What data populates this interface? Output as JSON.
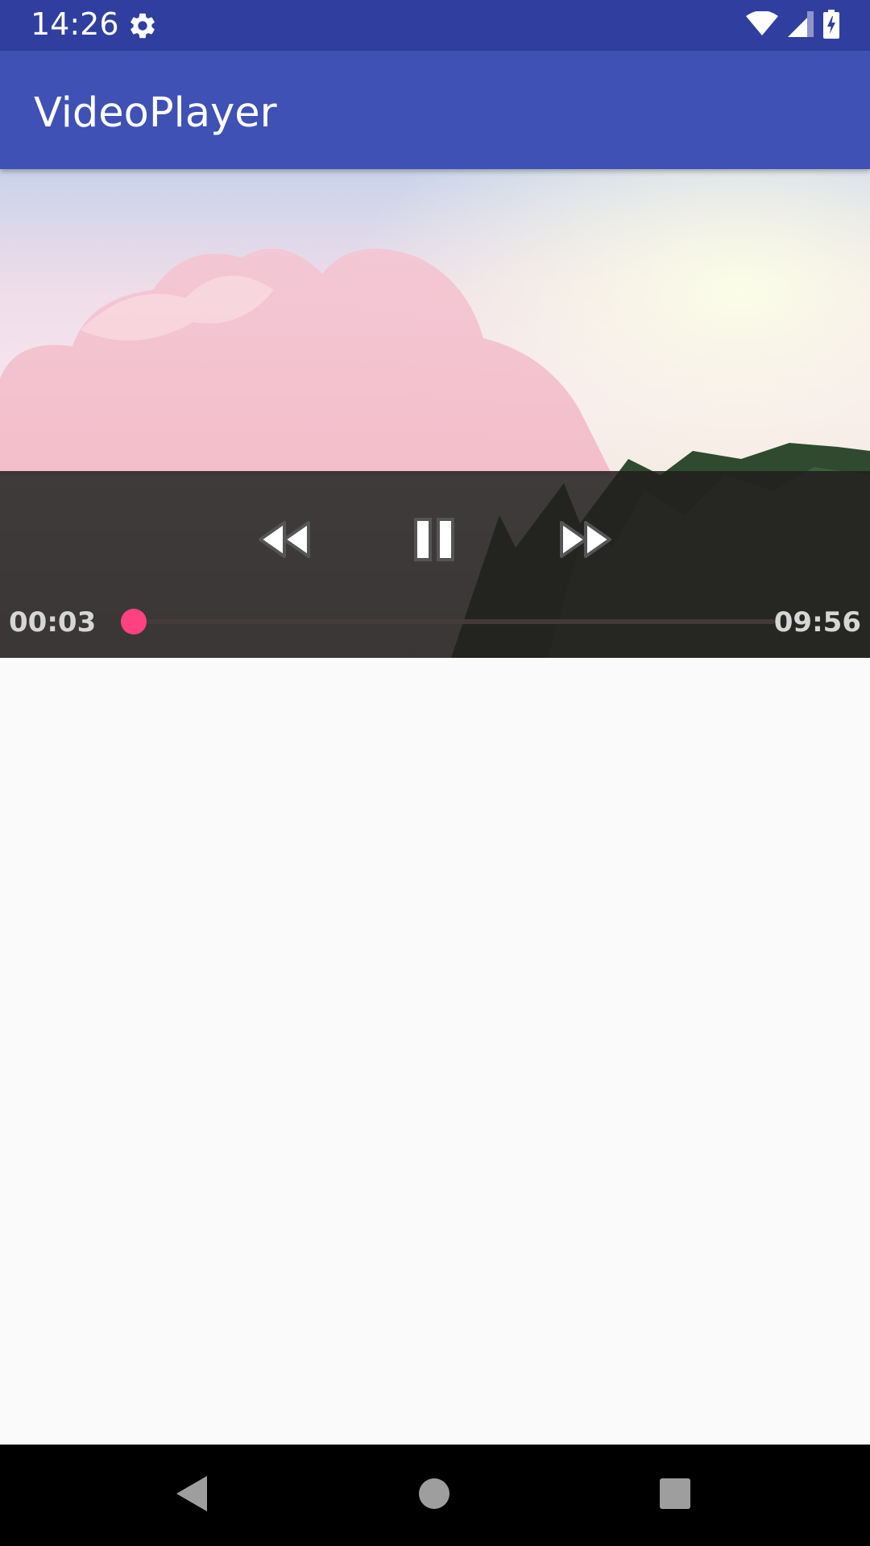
{
  "status_bar": {
    "time": "14:26",
    "icons": [
      "gear-icon",
      "wifi-icon",
      "signal-icon",
      "battery-charging-icon"
    ],
    "background": "#303f9f"
  },
  "app_bar": {
    "title": "VideoPlayer",
    "background": "#3f51b5"
  },
  "player": {
    "controls": {
      "rewind_icon": "rewind-icon",
      "pause_icon": "pause-icon",
      "fast_forward_icon": "fast-forward-icon"
    },
    "current_time": "00:03",
    "total_time": "09:56",
    "progress_fraction": 0.005,
    "accent": "#ff4081"
  },
  "nav_bar": {
    "icons": [
      "back-icon",
      "home-icon",
      "recents-icon"
    ]
  }
}
